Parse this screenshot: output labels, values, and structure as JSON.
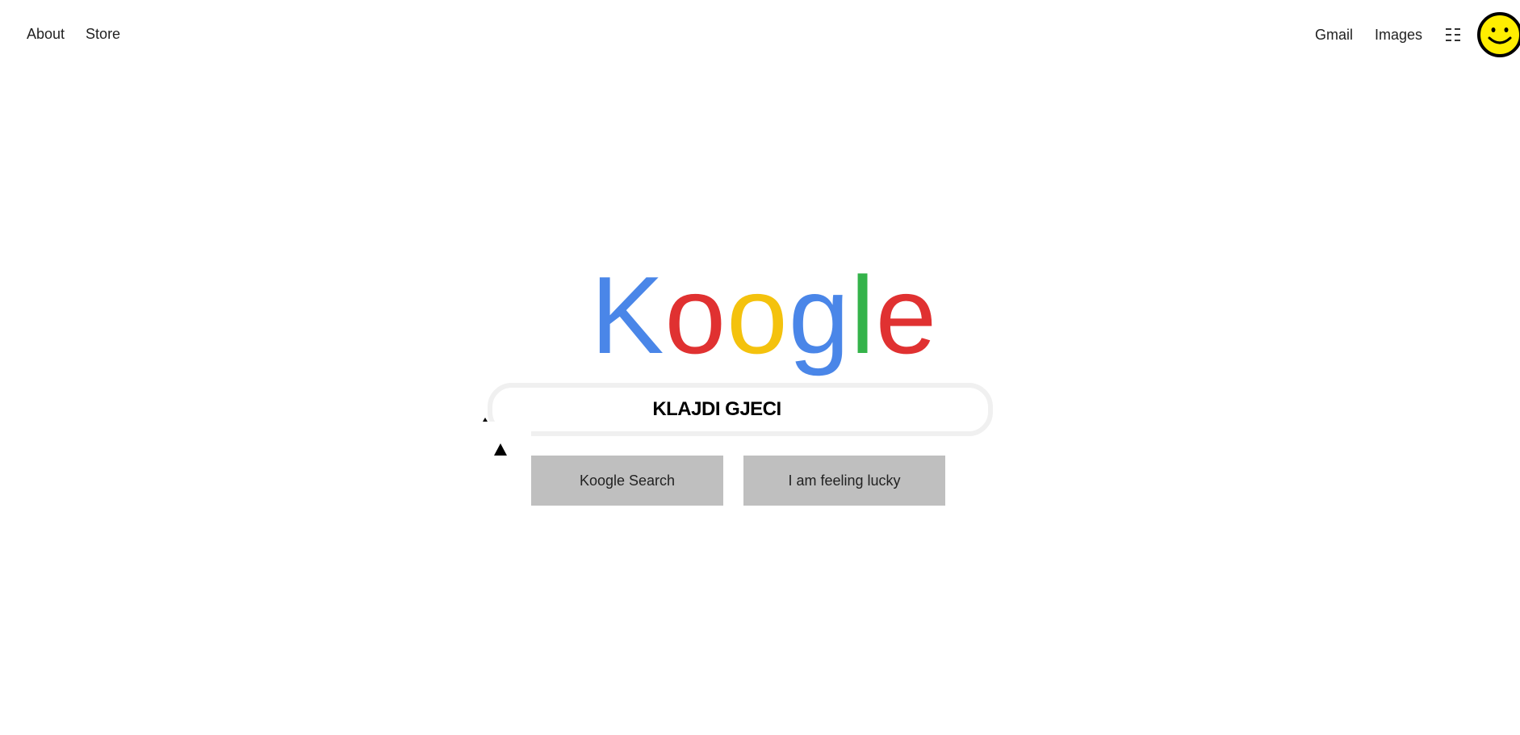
{
  "header": {
    "left_links": [
      {
        "label": "About"
      },
      {
        "label": "Store"
      }
    ],
    "right_links": [
      {
        "label": "Gmail"
      },
      {
        "label": "Images"
      }
    ],
    "apps_icon": "grid-icon",
    "avatar_icon": "smiley-face-icon"
  },
  "logo": {
    "letters": [
      {
        "char": "K",
        "color": "#4a86e8"
      },
      {
        "char": "o",
        "color": "#e03131"
      },
      {
        "char": "o",
        "color": "#f4c20d"
      },
      {
        "char": "g",
        "color": "#4a86e8"
      },
      {
        "char": "l",
        "color": "#34b34a"
      },
      {
        "char": "e",
        "color": "#e03131"
      }
    ]
  },
  "search": {
    "value": "KLAJDI GJECI",
    "placeholder": ""
  },
  "buttons": {
    "search_label": "Koogle Search",
    "lucky_label": "I am feeling lucky"
  },
  "colors": {
    "button_bg": "#bfbfbf",
    "search_border": "#f0f0f0",
    "avatar_face": "#ffee00"
  }
}
